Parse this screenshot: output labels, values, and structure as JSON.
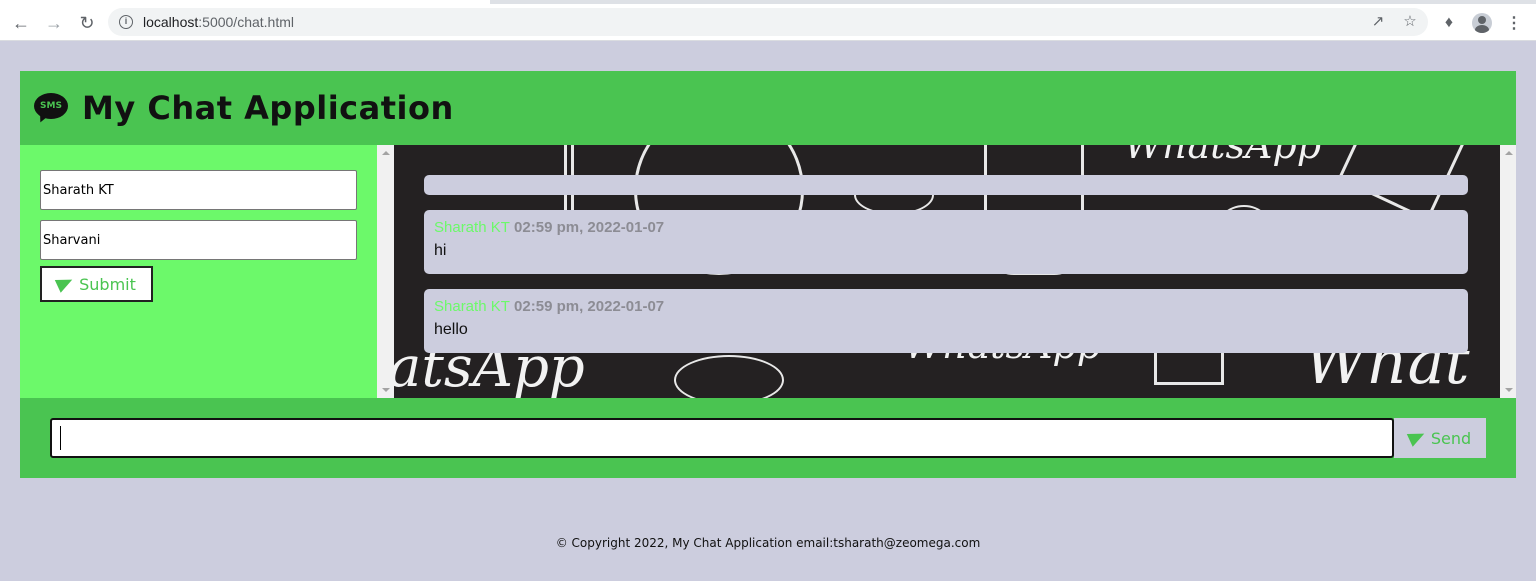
{
  "browser": {
    "url_host": "localhost",
    "url_path": ":5000/chat.html"
  },
  "app": {
    "title": "My Chat Application",
    "icon_label": "SMS",
    "sidebar": {
      "name_value": "Sharath KT",
      "recipient_value": "Sharvani",
      "submit_label": "Submit"
    },
    "messages": [
      {
        "name": "Sharath KT",
        "meta": "02:59 pm, 2022-01-07",
        "text": "hi"
      },
      {
        "name": "Sharath KT",
        "meta": "02:59 pm, 2022-01-07",
        "text": "hello"
      }
    ],
    "composer": {
      "value": "",
      "send_label": "Send"
    },
    "background_text": [
      "WhatsApp",
      "atsApp",
      "What"
    ]
  },
  "footer": {
    "copyright": "© Copyright 2022, My Chat Application email:tsharath@zeomega.com"
  },
  "colors": {
    "header_green": "#4ac451",
    "sidebar_green": "#6cf96a",
    "page_bg": "#cccdde",
    "chat_bg": "#242122"
  }
}
